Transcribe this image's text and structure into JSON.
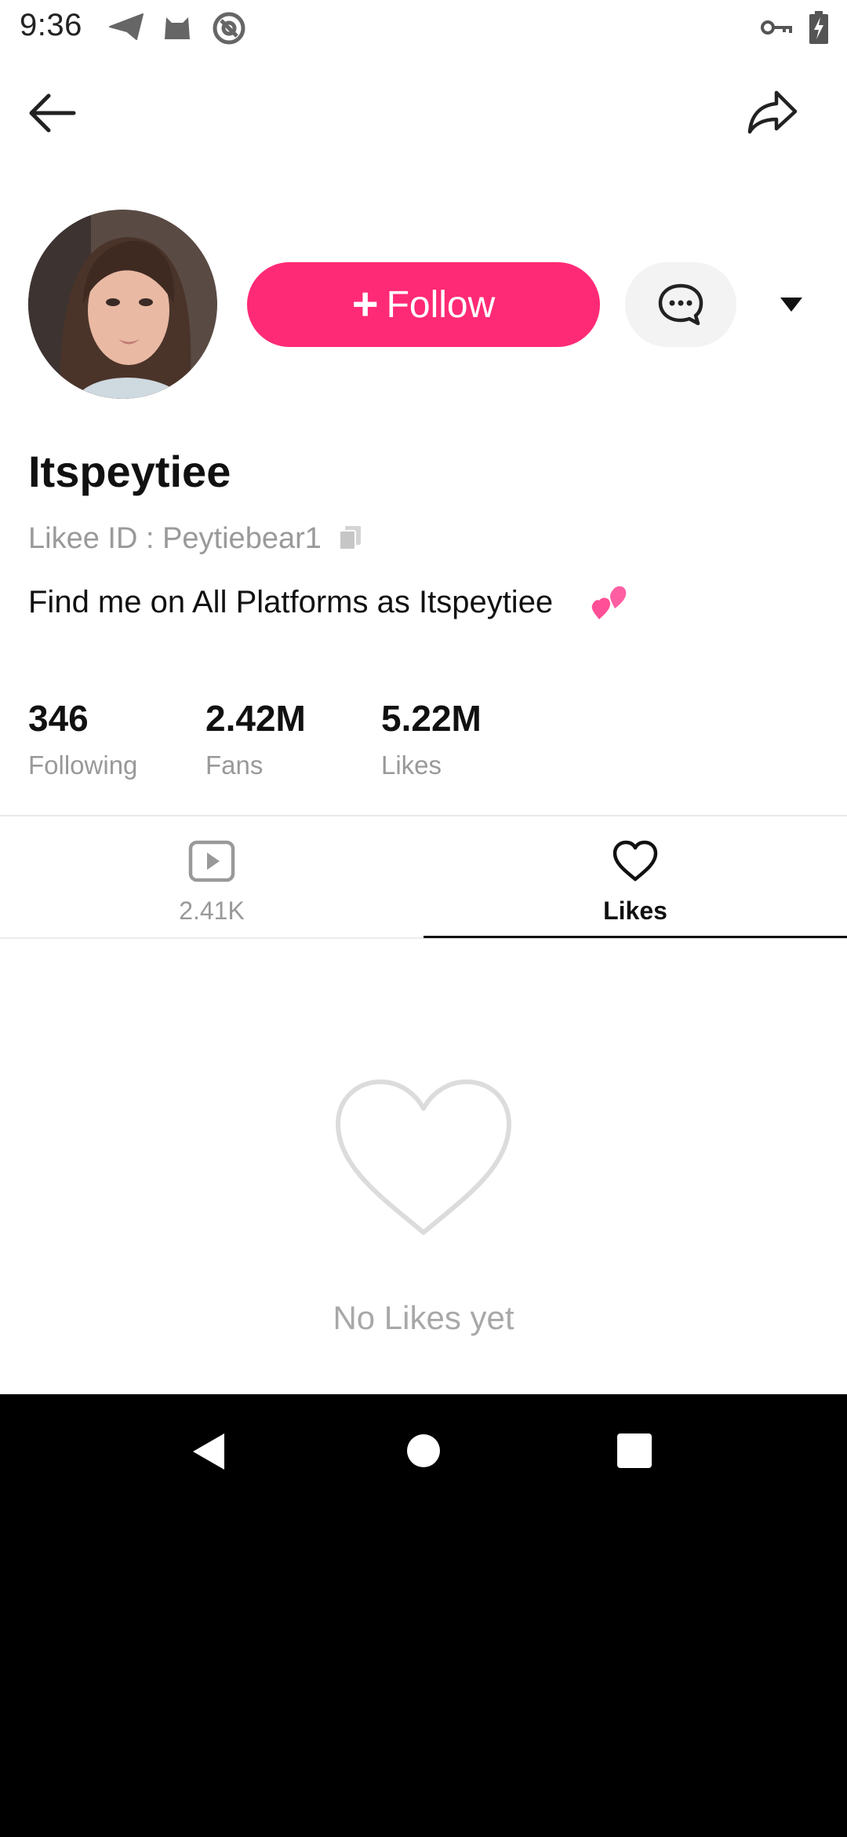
{
  "status_bar": {
    "time": "9:36",
    "left_icons": [
      "paper-plane-icon",
      "cat-icon",
      "at-sign-icon"
    ],
    "right_icons": [
      "key-icon",
      "battery-charging-icon"
    ]
  },
  "header": {
    "back_icon": "arrow-left-icon",
    "share_icon": "share-arrow-icon"
  },
  "profile": {
    "follow_label": "Follow",
    "username": "Itspeytiee",
    "likee_id": "Likee ID : Peytiebear1",
    "bio": "Find me on All Platforms as Itspeytiee",
    "bio_emoji": "💕"
  },
  "stats": [
    {
      "value": "346",
      "label": "Following"
    },
    {
      "value": "2.42M",
      "label": "Fans"
    },
    {
      "value": "5.22M",
      "label": "Likes"
    }
  ],
  "tabs": [
    {
      "label": "2.41K",
      "icon": "video-play-icon",
      "active": false
    },
    {
      "label": "Likes",
      "icon": "heart-outline-icon",
      "active": true
    }
  ],
  "empty_state": {
    "text": "No Likes yet",
    "icon": "heart-outline-icon"
  },
  "nav_bar": {
    "icons": [
      "back-triangle-icon",
      "home-circle-icon",
      "recents-square-icon"
    ]
  },
  "colors": {
    "accent": "#ff2a76",
    "muted_text": "#9a9a9a",
    "background": "#ffffff"
  }
}
